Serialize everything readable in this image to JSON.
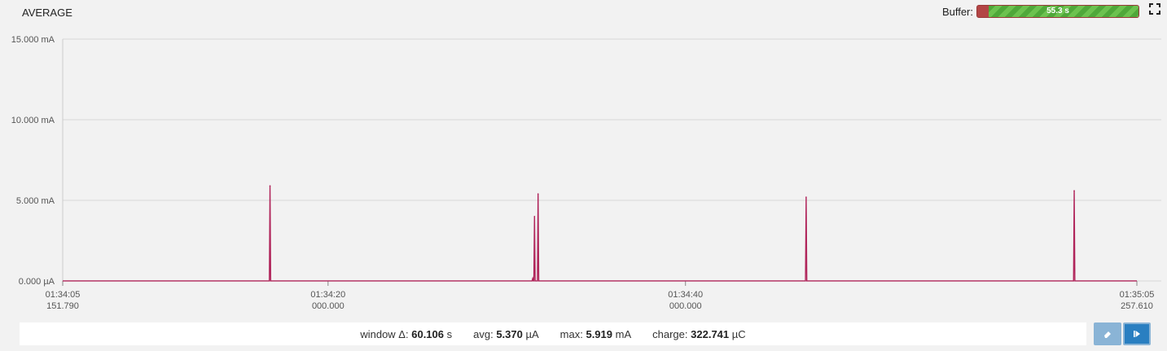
{
  "header": {
    "title": "AVERAGE",
    "buffer_label": "Buffer:",
    "buffer_value": "55.3 s",
    "buffer_fraction": 0.93
  },
  "colors": {
    "line": "#b0245a",
    "grid": "#d8d8d8",
    "accent": "#2a7fc1"
  },
  "icons": {
    "expand": "expand-icon",
    "clear": "eraser-icon",
    "play": "play-icon"
  },
  "chart_data": {
    "type": "line",
    "title": "",
    "xlabel": "",
    "ylabel": "",
    "ylim": [
      0,
      15
    ],
    "y_unit": "mA",
    "y_ticks": [
      "15.000 mA",
      "10.000 mA",
      "5.000 mA",
      "0.000 µA"
    ],
    "xlim": [
      0,
      60.106
    ],
    "x_ticks": [
      {
        "t": 0,
        "time": "01:34:05",
        "sub": "151.790"
      },
      {
        "t": 14.848,
        "time": "01:34:20",
        "sub": "000.000"
      },
      {
        "t": 34.848,
        "time": "01:34:40",
        "sub": "000.000"
      },
      {
        "t": 60.106,
        "time": "01:35:05",
        "sub": "257.610"
      }
    ],
    "baseline": 0.005,
    "spikes": [
      {
        "t": 11.6,
        "value": 5.9
      },
      {
        "t": 26.3,
        "value": 0.15
      },
      {
        "t": 26.4,
        "value": 4.0
      },
      {
        "t": 26.6,
        "value": 5.4
      },
      {
        "t": 41.6,
        "value": 5.2
      },
      {
        "t": 56.6,
        "value": 5.6
      }
    ]
  },
  "stats": {
    "window_label": "window Δ:",
    "window_value": "60.106",
    "window_unit": "s",
    "avg_label": "avg:",
    "avg_value": "5.370",
    "avg_unit": "µA",
    "max_label": "max:",
    "max_value": "5.919",
    "max_unit": "mA",
    "charge_label": "charge:",
    "charge_value": "322.741",
    "charge_unit": "µC"
  }
}
